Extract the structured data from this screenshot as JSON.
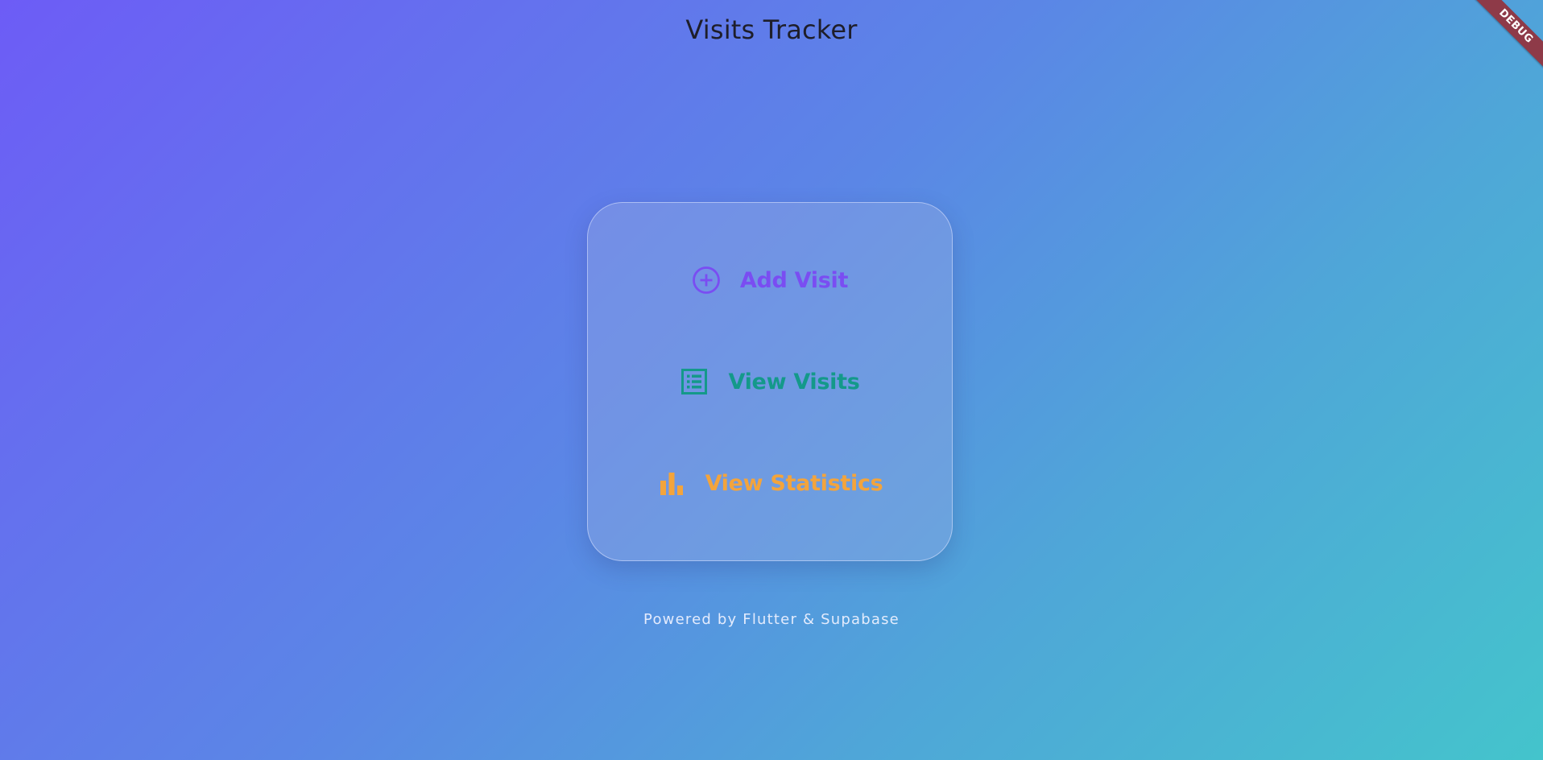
{
  "app": {
    "title": "Visits Tracker"
  },
  "menu": {
    "items": [
      {
        "label": "Add Visit",
        "icon": "add-circle-icon",
        "color": "#7a4df2"
      },
      {
        "label": "View Visits",
        "icon": "list-icon",
        "color": "#14998a"
      },
      {
        "label": "View Statistics",
        "icon": "bar-chart-icon",
        "color": "#f3a43c"
      }
    ]
  },
  "footer": {
    "text": "Powered by Flutter & Supabase"
  },
  "debug_banner": {
    "label": "DEBUG",
    "color": "#8e3a48"
  },
  "theme": {
    "gradient_start": "#6d5cf6",
    "gradient_end": "#44c4cc"
  }
}
